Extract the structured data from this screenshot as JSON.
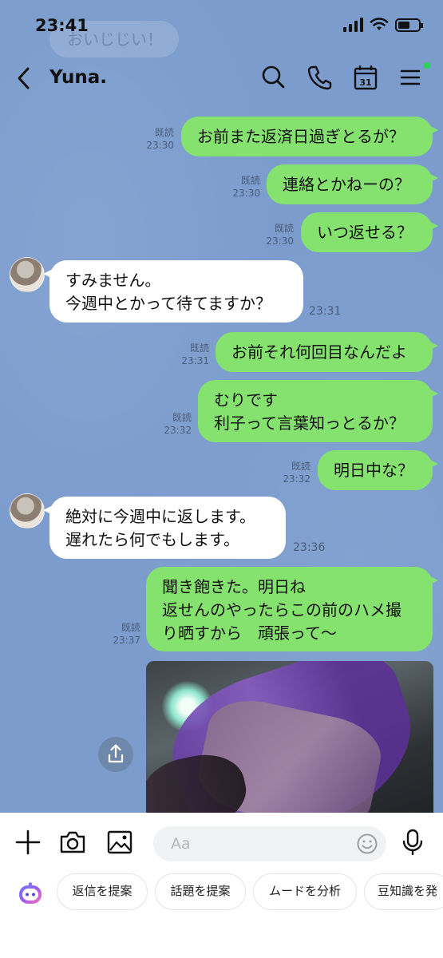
{
  "status_bar": {
    "time": "23:41"
  },
  "previous_message": {
    "text": "おいじじい！"
  },
  "header": {
    "contact_name": "Yuna."
  },
  "messages": [
    {
      "text": "お前また返済日過ぎとるが？",
      "read": "既読",
      "time": "23:30"
    },
    {
      "text": "連絡とかねーの？",
      "read": "既読",
      "time": "23:30"
    },
    {
      "text": "いつ返せる？",
      "read": "既読",
      "time": "23:30"
    },
    {
      "text": "すみません。\n今週中とかって待てますか？",
      "time": "23:31"
    },
    {
      "text": "お前それ何回目なんだよ",
      "read": "既読",
      "time": "23:31"
    },
    {
      "text": "むりです\n利子って言葉知っとるか？",
      "read": "既読",
      "time": "23:32"
    },
    {
      "text": "明日中な？",
      "read": "既読",
      "time": "23:32"
    },
    {
      "text": "絶対に今週中に返します。\n遅れたら何でもします。",
      "time": "23:36"
    },
    {
      "text": "聞き飽きた。明日ね\n返せんのやったらこの前のハメ撮\nり晒すから　頑張って〜",
      "read": "既読",
      "time": "23:37"
    }
  ],
  "input": {
    "placeholder": "Aa"
  },
  "suggestions": [
    {
      "label": "返信を提案"
    },
    {
      "label": "話題を提案"
    },
    {
      "label": "ムードを分析"
    },
    {
      "label": "豆知識を発"
    }
  ],
  "colors": {
    "chat_background": "#7b9ccd",
    "my_bubble": "#85e26f",
    "their_bubble": "#ffffff",
    "notification_dot": "#25d94a"
  },
  "icons": [
    "back-icon",
    "search-icon",
    "phone-icon",
    "calendar-icon",
    "menu-icon",
    "share-icon",
    "plus-icon",
    "camera-icon",
    "image-icon",
    "emoji-icon",
    "mic-icon",
    "ai-assistant-icon"
  ]
}
